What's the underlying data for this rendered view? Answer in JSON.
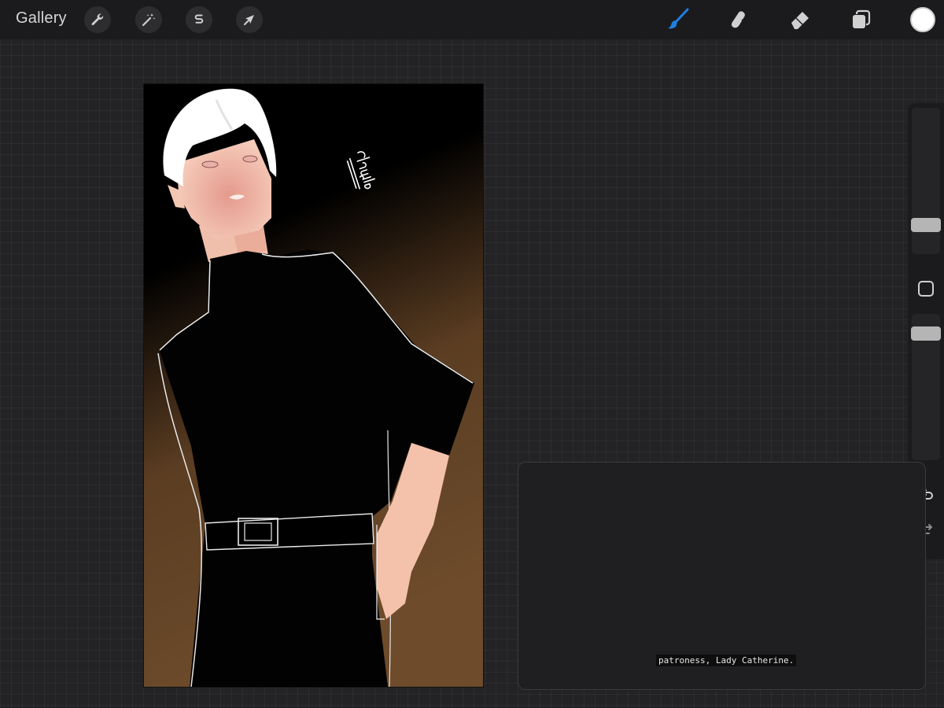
{
  "topbar": {
    "gallery_label": "Gallery",
    "left_tools": [
      {
        "name": "actions",
        "icon": "wrench-icon"
      },
      {
        "name": "adjustments",
        "icon": "magic-wand-icon"
      },
      {
        "name": "selection",
        "icon": "selection-s-icon"
      },
      {
        "name": "transform",
        "icon": "arrow-cursor-icon"
      }
    ],
    "right_tools": [
      {
        "name": "brush",
        "icon": "brush-icon",
        "active": true
      },
      {
        "name": "smudge",
        "icon": "smudge-icon",
        "active": false
      },
      {
        "name": "eraser",
        "icon": "eraser-icon",
        "active": false
      },
      {
        "name": "layers",
        "icon": "layers-icon",
        "active": false
      }
    ],
    "current_color": "#ffffff"
  },
  "canvas": {
    "signature_text": "Claudia",
    "background_colors": [
      "#000000",
      "#6b4a2c"
    ],
    "skin_color": "#f2c2ad",
    "hair_color": "#ffffff"
  },
  "sidebar": {
    "brush_size_level": 0.2,
    "opacity_level": 0.15,
    "icons": [
      "modify-square-icon",
      "undo-icon",
      "redo-icon"
    ]
  },
  "popup": {
    "caption": "patroness, Lady Catherine."
  },
  "colors": {
    "accent": "#1f7fe0",
    "topbar_bg": "#1b1b1d",
    "workspace_bg": "#232325"
  }
}
